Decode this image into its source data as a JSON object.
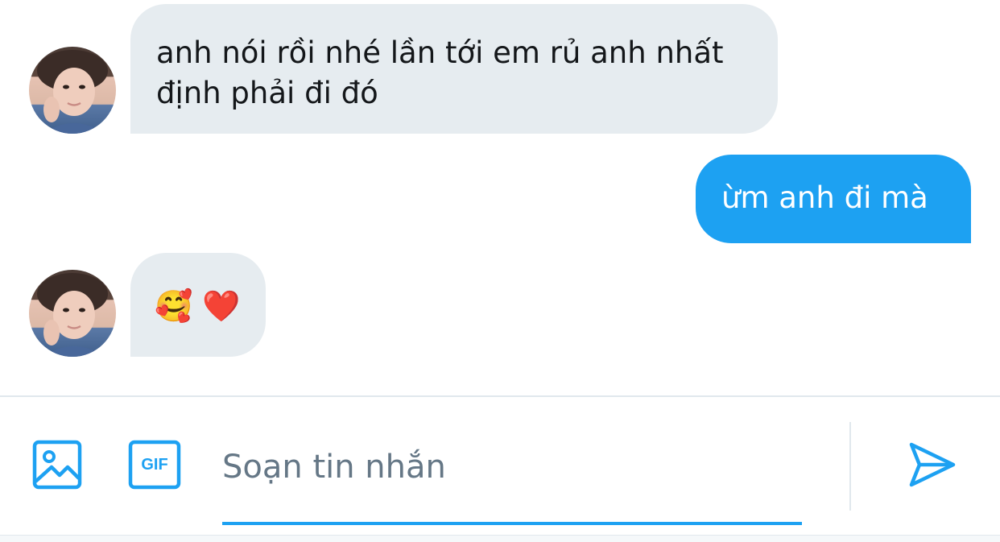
{
  "conversation": {
    "messages": [
      {
        "direction": "incoming",
        "text": "anh nói rồi nhé lần tới em rủ anh nhất định phải đi đó"
      },
      {
        "direction": "outgoing",
        "text": "ừm anh đi mà"
      },
      {
        "direction": "incoming",
        "text": "🥰 ❤️"
      }
    ]
  },
  "composer": {
    "placeholder": "Soạn tin nhắn",
    "value": "",
    "gif_label": "GIF",
    "icons": {
      "media": "image-icon",
      "gif": "gif-icon",
      "send": "send-icon"
    }
  },
  "colors": {
    "accent": "#1da1f2",
    "incoming_bubble": "#e6ecf0",
    "text": "#14171a",
    "placeholder": "#657786",
    "divider": "#e1e8ed"
  }
}
